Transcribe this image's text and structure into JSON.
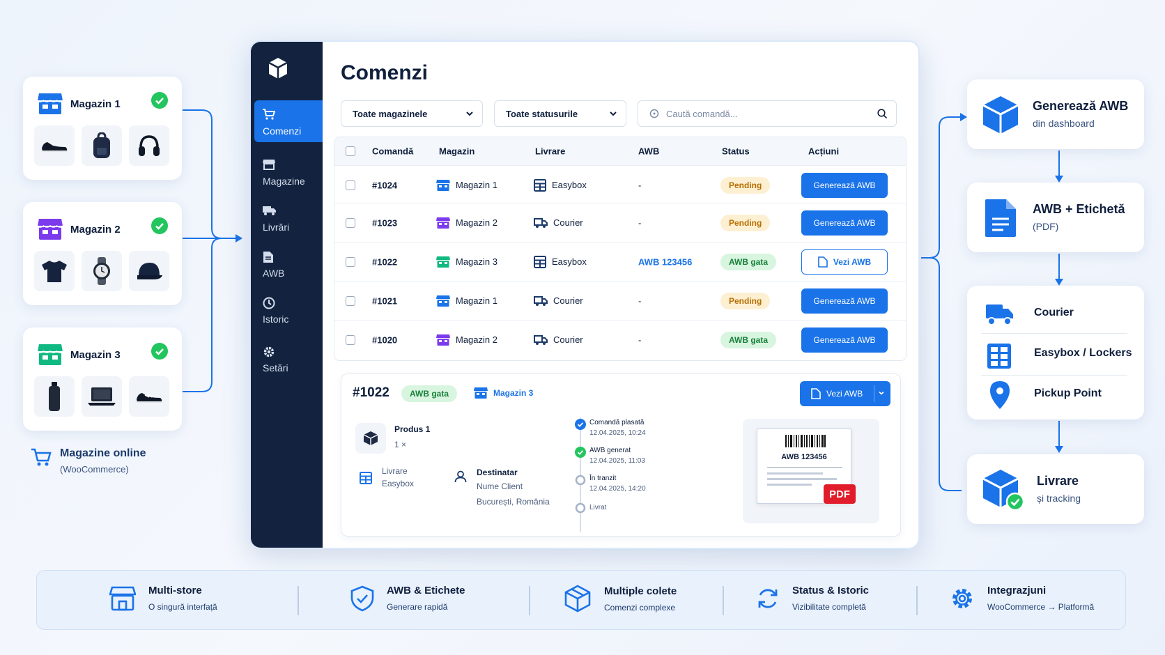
{
  "stores": [
    {
      "name": "Magazin 1",
      "color": "#1a73e8",
      "products": [
        "sneaker-icon",
        "backpack-icon",
        "headphones-icon"
      ]
    },
    {
      "name": "Magazin 2",
      "color": "#7c3aed",
      "products": [
        "tshirt-icon",
        "watch-icon",
        "cap-icon"
      ]
    },
    {
      "name": "Magazin 3",
      "color": "#10b981",
      "products": [
        "bottle-icon",
        "laptop-icon",
        "sneaker-icon"
      ]
    }
  ],
  "online": {
    "title": "Magazine online",
    "subtitle": "(WooCommerce)"
  },
  "sidebar": {
    "items": [
      {
        "label": "Comenzi",
        "icon": "cart-icon",
        "active": true
      },
      {
        "label": "Magazine",
        "icon": "store-icon",
        "active": false
      },
      {
        "label": "Livrări",
        "icon": "truck-icon",
        "active": false
      },
      {
        "label": "AWB",
        "icon": "document-icon",
        "active": false
      },
      {
        "label": "Istoric",
        "icon": "clock-icon",
        "active": false
      },
      {
        "label": "Setări",
        "icon": "gear-icon",
        "active": false
      }
    ]
  },
  "main": {
    "title": "Comenzi",
    "filters": {
      "stores": "Toate magazinele",
      "statuses": "Toate statusurile",
      "search_placeholder": "Caută comandă..."
    }
  },
  "table": {
    "headers": [
      "Comandă",
      "Magazin",
      "Livrare",
      "AWB",
      "Status",
      "Acțiuni"
    ],
    "rows": [
      {
        "id": "#1024",
        "store": "Magazin 1",
        "delivery": "Easybox",
        "awb": "-",
        "status": "Pending",
        "action": "Generează AWB"
      },
      {
        "id": "#1023",
        "store": "Magazin 2",
        "delivery": "Courier",
        "awb": "-",
        "status": "Pending",
        "action": "Generează AWB"
      },
      {
        "id": "#1022",
        "store": "Magazin 3",
        "delivery": "Easybox",
        "awb": "AWB 123456",
        "status": "AWB gata",
        "action": "Vezi AWB"
      },
      {
        "id": "#1021",
        "store": "Magazin 1",
        "delivery": "Courier",
        "awb": "-",
        "status": "Pending",
        "action": "Generează AWB"
      },
      {
        "id": "#1020",
        "store": "Magazin 2",
        "delivery": "Courier",
        "awb": "-",
        "status": "AWB gata",
        "action": "Generează AWB"
      }
    ]
  },
  "detail": {
    "id": "#1022",
    "status": "AWB gata",
    "store": "Magazin 3",
    "view_button": "Vezi AWB",
    "product": {
      "name": "Produs 1",
      "qty": "1 ×"
    },
    "delivery": {
      "label": "Livrare",
      "value": "Easybox"
    },
    "recipient": {
      "label": "Destinatar",
      "name": "Nume Client",
      "city": "București, România"
    },
    "timeline": [
      {
        "label": "Comandă plasată",
        "date": "12.04.2025, 10:24",
        "done": true
      },
      {
        "label": "AWB generat",
        "date": "12.04.2025, 11:03",
        "done": true
      },
      {
        "label": "În tranzit",
        "date": "12.04.2025, 14:20",
        "done": false
      },
      {
        "label": "Livrat",
        "date": "",
        "done": false
      }
    ],
    "label_preview": {
      "awb": "AWB 123456",
      "badge": "PDF"
    }
  },
  "flow": [
    {
      "title": "Generează AWB",
      "subtitle": "din dashboard",
      "icon": "box-icon"
    },
    {
      "title": "AWB + Etichetă",
      "subtitle": "(PDF)",
      "icon": "file-icon"
    },
    {
      "options": [
        {
          "label": "Courier",
          "icon": "truck-icon"
        },
        {
          "label": "Easybox / Lockers",
          "icon": "locker-icon"
        },
        {
          "label": "Pickup Point",
          "icon": "pin-icon"
        }
      ]
    },
    {
      "title": "Livrare",
      "subtitle": "și tracking",
      "icon": "box-check-icon"
    }
  ],
  "features": [
    {
      "title": "Multi-store",
      "subtitle": "O singură interfață",
      "icon": "store-icon"
    },
    {
      "title": "AWB & Etichete",
      "subtitle": "Generare rapidă",
      "icon": "shield-check-icon"
    },
    {
      "title": "Multiple colete",
      "subtitle": "Comenzi complexe",
      "icon": "boxes-icon"
    },
    {
      "title": "Status & Istoric",
      "subtitle": "Vizibilitate completă",
      "icon": "refresh-icon"
    },
    {
      "title": "Integrazjuni",
      "subtitle": "WooCommerce → Platformă",
      "icon": "gear-icon"
    }
  ],
  "colors": {
    "accent": "#1a73e8",
    "sidebar": "#13233f",
    "pending": "#b86e00",
    "ready": "#17803a"
  }
}
